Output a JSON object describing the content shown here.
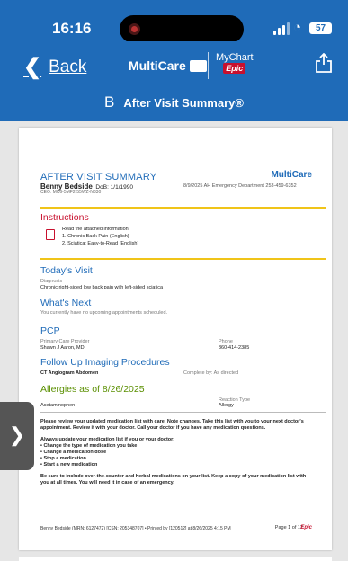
{
  "status_bar": {
    "time": "16:16",
    "battery": "57"
  },
  "nav": {
    "back_label": "Back",
    "brand": "MultiCare",
    "mychart_top": "My",
    "mychart_mid": "Chart",
    "epic": "Epic",
    "share_icon": "share-icon"
  },
  "title": {
    "letter": "B",
    "text": "After Visit Summary®"
  },
  "doc": {
    "brand": "MultiCare",
    "avs_title": "AFTER VISIT SUMMARY",
    "patient_name": "Benny Bedside",
    "dob": "DoB: 1/1/1990",
    "csn": "CEO: MC6-5MF2-55WZ-N830",
    "visit": "8/9/2025   AH Emergency Department   253-459-6352",
    "instructions_h": "Instructions",
    "instructions_read": "Read the attached information",
    "instructions_1": "1.  Chronic Back Pain (English)",
    "instructions_2": "2.  Sciatica: Easy-to-Read (English)",
    "todays_visit_h": "Today's Visit",
    "diagnosis_label": "Diagnosis",
    "diagnosis": "Chronic right-sided low back pain with left-sided sciatica",
    "whats_next_h": "What's Next",
    "whats_next": "You currently have no upcoming appointments scheduled.",
    "pcp_h": "PCP",
    "pcp_label": "Primary Care Provider",
    "pcp_name": "Shawn J Aaron, MD",
    "phone_label": "Phone",
    "phone": "360-414-2385",
    "imaging_h": "Follow Up Imaging Procedures",
    "imaging_name": "CT Angiogram Abdomen",
    "imaging_complete": "Complete by: As directed",
    "allergies_h": "Allergies as of 8/26/2025",
    "reaction_type": "Reaction Type",
    "allergen": "Acetaminophen",
    "allergy_type": "Allergy",
    "review_1": "Please review your updated medication list with care.  Note changes.  Take this list with you to your next doctor's",
    "review_2": "appointment.  Review it with your doctor.  Call your doctor if you have any medication questions.",
    "always_h": "Always update your medication list if you or your doctor:",
    "always_1": "• Change the type of medication you take",
    "always_2": "• Change a medication dose",
    "always_3": "• Stop a medication",
    "always_4": "• Start a new medication",
    "otc_1": "Be sure to include over-the-counter and herbal medications on your list.  Keep a copy of your medication list with",
    "otc_2": "you at all times.  You will need it in case of an emergency.",
    "footer": "Benny Bedside (MRN: 6127472) [CSN: 205348707] • Printed by [120512] at 8/26/2025 4:15 PM",
    "page": "Page 1 of 12",
    "footer_epic": "Epic"
  },
  "side_handle_icon": "chevron-right-icon",
  "colors": {
    "header": "#1f6bb8",
    "red": "#c8102e",
    "gold": "#f0c419"
  }
}
